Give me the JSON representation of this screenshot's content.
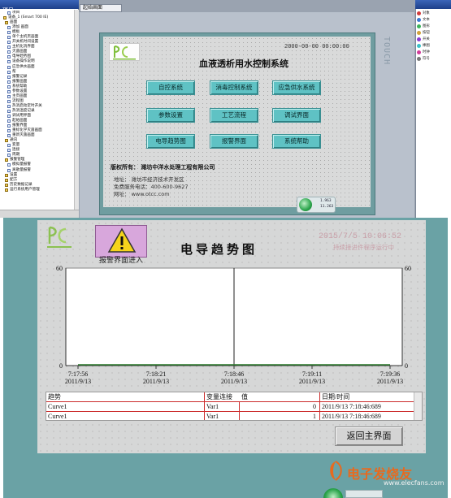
{
  "ide": {
    "tree_title": "项目",
    "editor_tab": "起始画面",
    "touch_label": "TOUCH",
    "tree_items": [
      "项目",
      "设备_1 (Smart 700 IE)",
      "画面",
      "添加 画面",
      "模板",
      "单个主机页画面",
      "开关机时间设置",
      "主机化消界面",
      "灭菌画面",
      "电导趋势图",
      "设备操作说明",
      "应急供水画面",
      "帮",
      "报警记录",
      "报警画面",
      "系统帮助",
      "参数设置",
      "主页画面",
      "流程图",
      "热消启动定时开关",
      "热消温度记录",
      "调试用界面",
      "起始画面",
      "报警界面",
      "重标化学灭菌画面",
      "重新灭菌画面",
      "通讯",
      "变量",
      "连接",
      "周期",
      "报警管理",
      "模拟量报警",
      "离散量报警",
      "设置",
      "配方",
      "历史数据记录",
      "运行系统用户管理"
    ],
    "right_panel_items": [
      "对象",
      "文本",
      "图形",
      "按钮",
      "开关",
      "棒图",
      "时钟",
      "符号"
    ]
  },
  "start_screen": {
    "datetime": "2000-00-00  00:00:00",
    "title": "血液透析用水控制系统",
    "buttons": [
      [
        "自控系统",
        "消毒控制系统",
        "应急供水系统"
      ],
      [
        "参数设置",
        "工艺流程",
        "调试界面"
      ],
      [
        "电导趋势图",
        "报警界面",
        "系统帮助"
      ]
    ],
    "copyright": "版权所有：  潍坊中洋水处理工程有限公司",
    "address": "地址：  潍坊市经济技术开发区",
    "hotline": "免费服务电话：400-600-9627",
    "website": "网址：  www.otcc.com",
    "status_values": [
      "1.963",
      "11.263"
    ]
  },
  "trend_screen": {
    "alarm_label": "报警界面进入",
    "title": "电导趋势图",
    "datetime": "2015/7/5 10:06:52",
    "tag": "持续接进件程序运行中",
    "return_button": "返回主界面"
  },
  "chart_data": {
    "type": "line",
    "y_left": {
      "min": 0,
      "max": 60,
      "ticks": [
        "60",
        "0"
      ]
    },
    "y_right": {
      "min": 0,
      "max": 60,
      "ticks": [
        "60",
        "0"
      ]
    },
    "x_ticks": [
      {
        "time": "7:17:56",
        "date": "2011/9/13"
      },
      {
        "time": "7:18:21",
        "date": "2011/9/13"
      },
      {
        "time": "7:18:46",
        "date": "2011/9/13"
      },
      {
        "time": "7:19:11",
        "date": "2011/9/13"
      },
      {
        "time": "7:19:36",
        "date": "2011/9/13"
      }
    ],
    "cursor_at": "7:18:46",
    "series": [
      {
        "name": "Curve1",
        "values": [
          0,
          0,
          0,
          0,
          0
        ],
        "color": "#2a7a2a"
      }
    ]
  },
  "trend_table": {
    "headers": [
      "趋势",
      "变量连接",
      "值",
      "日期/时间"
    ],
    "rows": [
      [
        "Curve1",
        "Var1",
        "0",
        "2011/9/13 7:18:46:689"
      ],
      [
        "Curve1",
        "Var1",
        "1",
        "2011/9/13 7:18:46:689"
      ]
    ]
  },
  "watermark": {
    "text": "电子发烧友",
    "domain": "www.elecfans.com"
  },
  "colors": {
    "hmi_frame": "#6aa2a5",
    "button_teal": "#5fc2c4",
    "alarm_magenta": "#d8a7dc",
    "table_line": "#cc2b2b"
  }
}
